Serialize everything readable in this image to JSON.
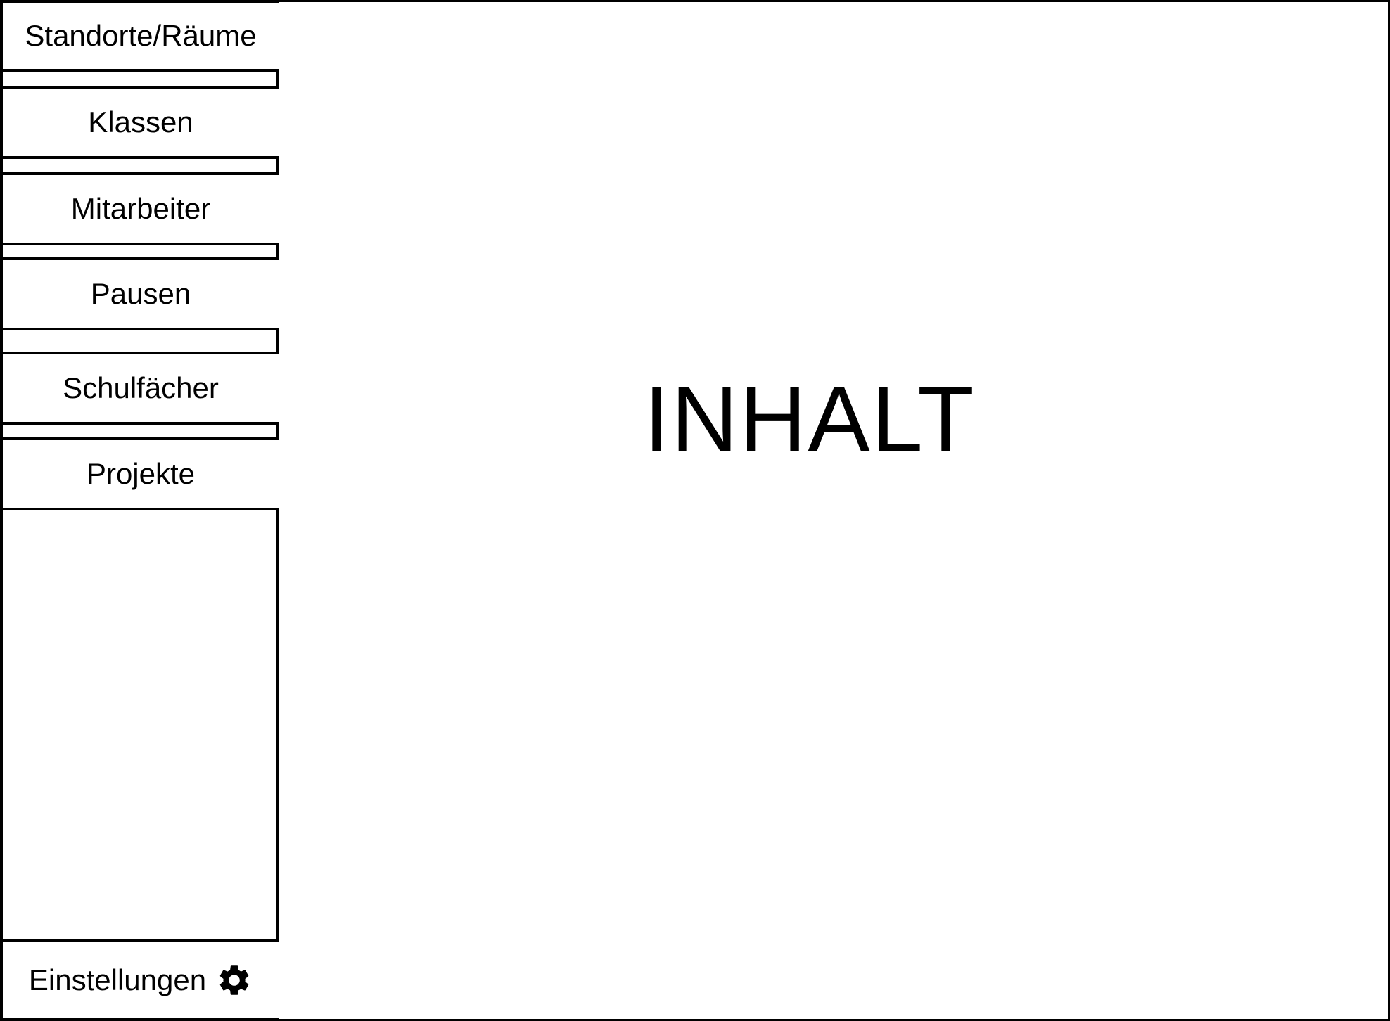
{
  "sidebar": {
    "items": [
      {
        "label": "Standorte/Räume"
      },
      {
        "label": "Klassen"
      },
      {
        "label": "Mitarbeiter"
      },
      {
        "label": "Pausen"
      },
      {
        "label": "Schulfächer"
      },
      {
        "label": "Projekte"
      }
    ],
    "settings": {
      "label": "Einstellungen",
      "icon": "gear-icon"
    }
  },
  "main": {
    "title": "INHALT"
  }
}
